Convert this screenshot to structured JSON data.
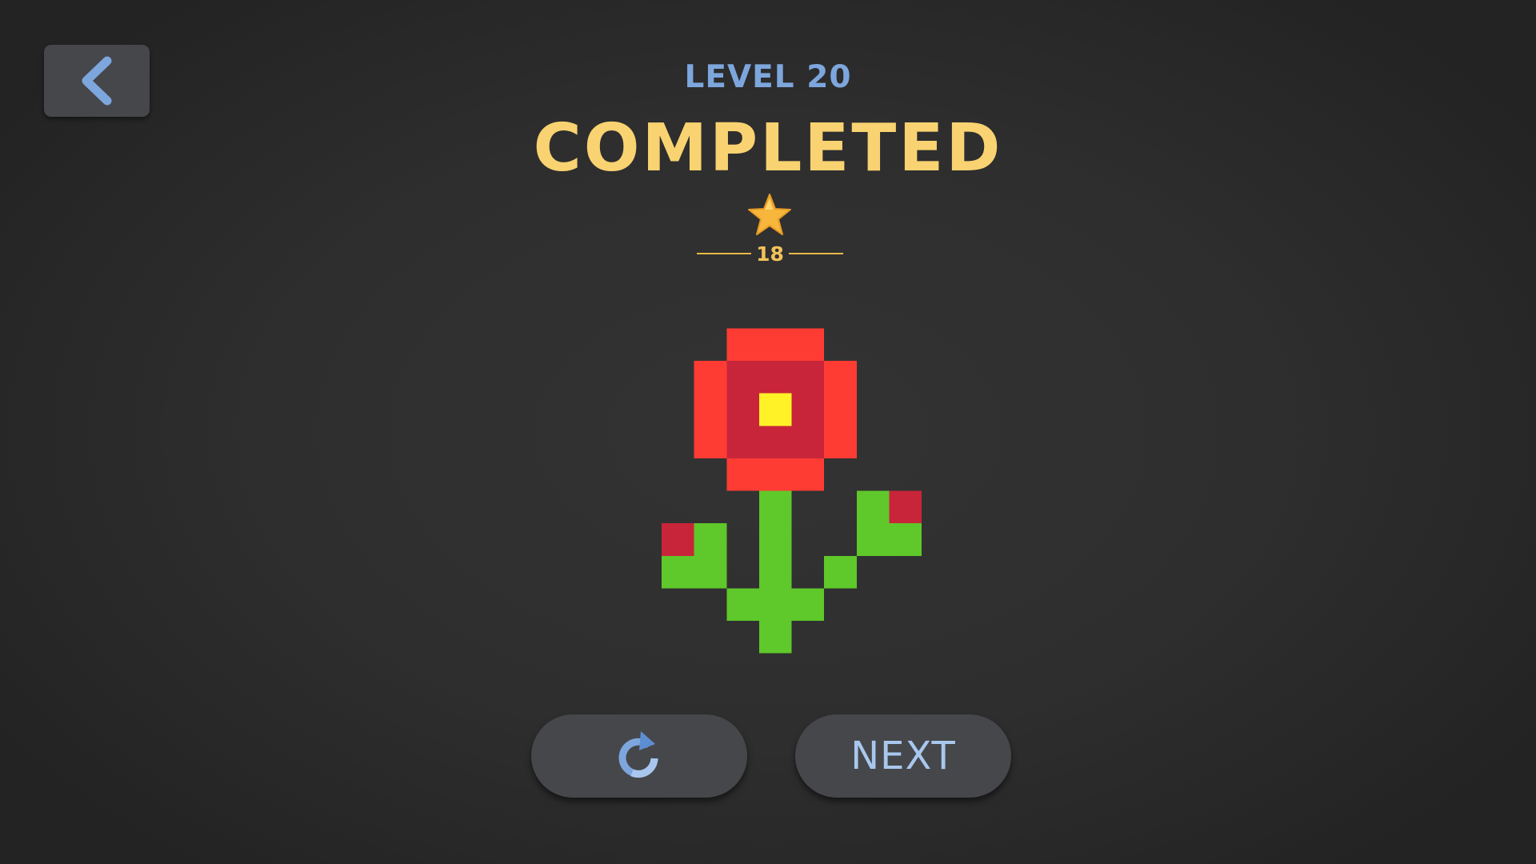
{
  "header": {
    "back_icon": "chevron-left-icon",
    "level_label": "LEVEL 20",
    "status_label": "COMPLETED"
  },
  "score": {
    "icon": "star-icon",
    "value": "18"
  },
  "artwork": {
    "subject": "pixel-flower",
    "colors": {
      "petal_light": "#ff3c34",
      "petal_dark": "#c8253a",
      "center": "#fff227",
      "stem": "#5fc82a"
    }
  },
  "actions": {
    "replay_icon": "replay-icon",
    "next_label": "NEXT"
  },
  "theme": {
    "background": "#2f2f2f",
    "button_bg": "#46474a",
    "accent_blue": "#7da6dd",
    "accent_gold": "#f9d371"
  }
}
